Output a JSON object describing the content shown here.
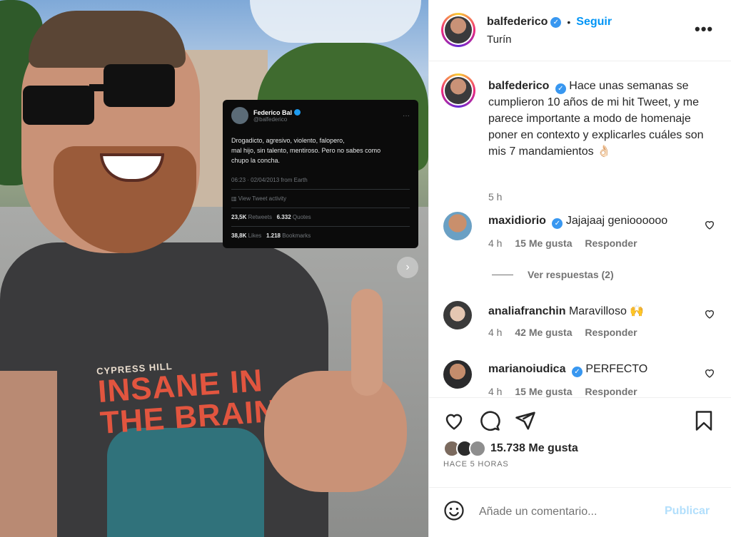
{
  "post": {
    "username": "balfederico",
    "follow_label": "Seguir",
    "separator": "•",
    "location": "Turín",
    "options_label": "•••",
    "caption": "Hace unas semanas se cumplieron 10 años de mi hit Tweet, y me parece importante a modo de homenaje poner en contexto y explicarles cuáles son mis 7 mandamientos 👌🏻",
    "caption_time": "5 h"
  },
  "photo": {
    "shirt_print_small": "CYPRESS HILL",
    "shirt_print_big": "INSANE IN THE BRAIN",
    "next_icon": "chevron-right-icon",
    "tweet": {
      "name": "Federico Bal",
      "handle": "@balfederico",
      "text": "Drogadicto, agresivo, violento, falopero,\nmal hijo, sin talento, mentiroso. Pero no sabes como\nchupo la concha.",
      "meta": "06:23 · 02/04/2013 from Earth",
      "activity": "View Tweet activity",
      "retweets_count": "23,5K",
      "retweets_label": "Retweets",
      "quotes_count": "6.332",
      "quotes_label": "Quotes",
      "likes_count": "38,8K",
      "likes_label": "Likes",
      "bookmarks_count": "1.218",
      "bookmarks_label": "Bookmarks"
    }
  },
  "comments": [
    {
      "user": "maxidiorio",
      "verified": true,
      "text": "Jajajaaj genioooooo",
      "time": "4 h",
      "likes": "15 Me gusta",
      "reply": "Responder"
    },
    {
      "user": "analiafranchin",
      "verified": false,
      "text": "Maravilloso 🙌",
      "time": "4 h",
      "likes": "42 Me gusta",
      "reply": "Responder"
    },
    {
      "user": "marianoiudica",
      "verified": true,
      "text": "PERFECTO",
      "time": "4 h",
      "likes": "15 Me gusta",
      "reply": "Responder"
    }
  ],
  "view_replies": "Ver respuestas (2)",
  "likes_total": "15.738 Me gusta",
  "time_ago": "HACE 5 HORAS",
  "composer": {
    "placeholder": "Añade un comentario...",
    "post_label": "Publicar"
  },
  "colors": {
    "link_blue": "#0095f6",
    "verified_blue": "#3897f0",
    "muted": "#737373",
    "publish_disabled": "#b2dffc"
  },
  "icons": [
    "verified-icon",
    "more-options-icon",
    "heart-icon",
    "comment-icon",
    "share-icon",
    "bookmark-icon",
    "emoji-icon"
  ]
}
